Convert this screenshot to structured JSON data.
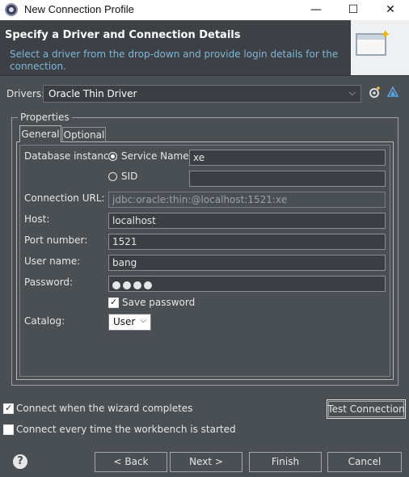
{
  "window": {
    "title": "New Connection Profile",
    "controls": {
      "minimize": "—",
      "maximize": "☐",
      "close": "✕"
    }
  },
  "header": {
    "title": "Specify a Driver and Connection Details",
    "description": "Select a driver from the drop-down and provide login details for the connection."
  },
  "drivers": {
    "label": "Drivers:",
    "selected": "Oracle Thin Driver"
  },
  "properties": {
    "group_label": "Properties",
    "tabs": [
      "General",
      "Optional"
    ],
    "database_instance_label": "Database instance:",
    "service_name_option": "Service Name",
    "service_name_value": "xe",
    "sid_option": "SID",
    "sid_value": "",
    "connection_url_label": "Connection URL:",
    "connection_url_value": "jdbc:oracle:thin:@localhost:1521:xe",
    "host_label": "Host:",
    "host_value": "localhost",
    "port_label": "Port number:",
    "port_value": "1521",
    "user_label": "User name:",
    "user_value": "bang",
    "password_label": "Password:",
    "save_password_label": "Save password",
    "catalog_label": "Catalog:",
    "catalog_value": "User"
  },
  "options": {
    "connect_when_complete": "Connect when the wizard completes",
    "connect_every_time": "Connect every time the workbench is started"
  },
  "buttons": {
    "test_connection": "Test Connection",
    "back": "< Back",
    "next": "Next >",
    "finish": "Finish",
    "cancel": "Cancel"
  }
}
